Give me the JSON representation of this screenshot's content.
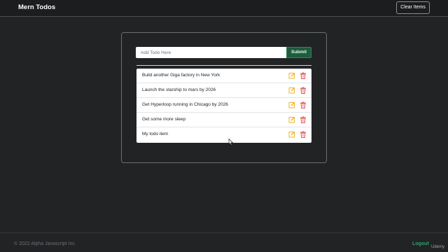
{
  "navbar": {
    "brand": "Mern Todos",
    "clear_label": "Clear Items"
  },
  "form": {
    "placeholder": "Add Todo Here",
    "submit_label": "Submit"
  },
  "todos": [
    {
      "text": "Build another Giga factory in New York"
    },
    {
      "text": "Launch the starship to mars by 2026"
    },
    {
      "text": "Get Hyperloop running in Chicago by 2026"
    },
    {
      "text": "Get some more sleep"
    },
    {
      "text": "My todo item"
    }
  ],
  "icons": {
    "edit": "pencil-square-icon",
    "delete": "trash-icon"
  },
  "colors": {
    "background": "#212325",
    "submit": "#1e5c3d",
    "edit_icon": "#f0b323",
    "delete_icon": "#e05a5a",
    "logout": "#2aa36b"
  },
  "footer": {
    "copyright": "© 2022 Alpha Javascript Inc",
    "logout_label": "Logout",
    "watermark": "Udemy"
  }
}
